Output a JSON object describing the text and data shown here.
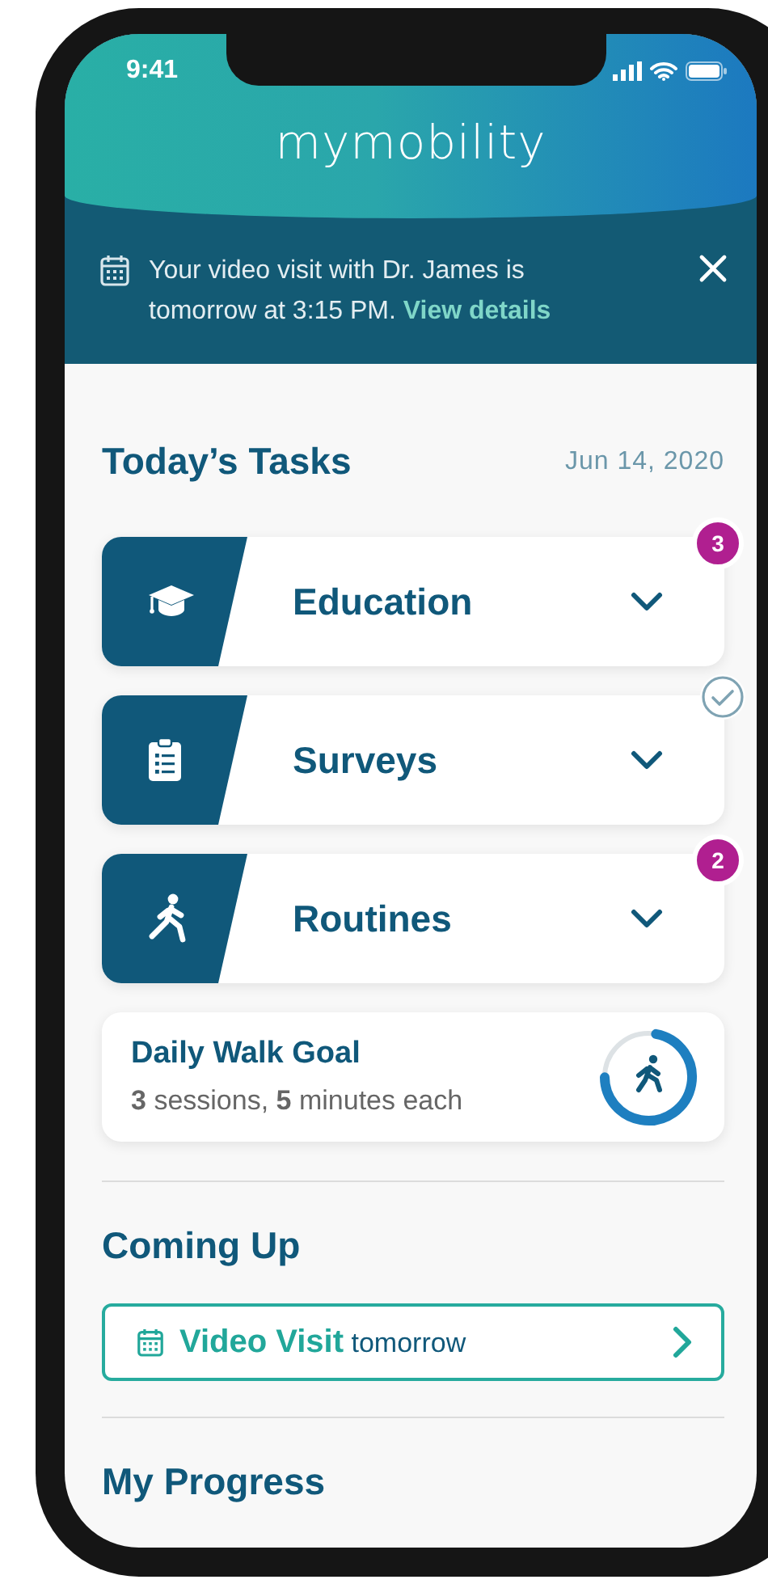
{
  "status_bar": {
    "time": "9:41"
  },
  "header": {
    "logo": "mymobility"
  },
  "banner": {
    "message": "Your video visit with Dr. James is tomorrow at 3:15 PM.",
    "link": "View details"
  },
  "today": {
    "title": "Today’s Tasks",
    "date": "Jun 14, 2020",
    "tasks": [
      {
        "label": "Education",
        "kind": "count",
        "badge": "3"
      },
      {
        "label": "Surveys",
        "kind": "done"
      },
      {
        "label": "Routines",
        "kind": "count",
        "badge": "2"
      }
    ]
  },
  "walk_goal": {
    "title": "Daily Walk Goal",
    "detail": "**3** sessions, **5** minutes each",
    "level": 0.72
  },
  "coming_up": {
    "title": "Coming Up",
    "items": [
      {
        "text": "**Video Visit** tomorrow"
      }
    ]
  },
  "progress": {
    "title": "My Progress"
  }
}
